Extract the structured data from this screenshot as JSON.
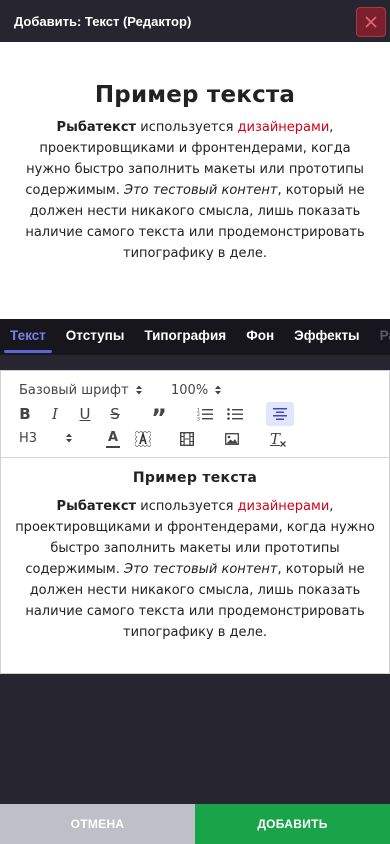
{
  "header": {
    "title": "Добавить: Текст (Редактор)"
  },
  "preview": {
    "title": "Пример текста",
    "p_bold": "Рыбатекст",
    "p_1": " используется ",
    "p_red": "дизайнерами",
    "p_2": ", проектировщиками и фронтендерами, когда нужно быстро заполнить макеты или прототипы содержимым. ",
    "p_italic": "Это тестовый контент",
    "p_3": ", который не должен нести никакого смысла, лишь показать наличие самого текста или продемонстрировать типографику в деле."
  },
  "tabs": [
    {
      "label": "Текст"
    },
    {
      "label": "Отступы"
    },
    {
      "label": "Типография"
    },
    {
      "label": "Фон"
    },
    {
      "label": "Эффекты"
    },
    {
      "label": "Ра"
    }
  ],
  "toolbar": {
    "font_select": "Базовый шрифт",
    "size_select": "100%",
    "heading_select": "H3",
    "bold_glyph": "B",
    "italic_glyph": "I",
    "underline_glyph": "U",
    "strike_glyph": "S",
    "quote_glyph": "”",
    "text_color_glyph": "A",
    "clear_glyph": "T"
  },
  "editor_content": {
    "title": "Пример текста",
    "p_bold": "Рыбатекст",
    "p_1": " используется ",
    "p_red": "дизайнерами",
    "p_2": ", проектировщиками и фронтендерами, когда нужно быстро заполнить макеты или прототипы содержимым. ",
    "p_italic": "Это тестовый контент",
    "p_3": ", который не должен нести никакого смысла, лишь показать наличие самого текста или продемонстрировать типографику в деле."
  },
  "footer": {
    "cancel_label": "ОТМЕНА",
    "add_label": "ДОБАВИТЬ"
  },
  "colors": {
    "accent": "#5f63d8",
    "red_text": "#d0021b",
    "add_green": "#1aa449",
    "cancel_grey": "#bfc0c7",
    "close_red": "#7a1f2b"
  }
}
